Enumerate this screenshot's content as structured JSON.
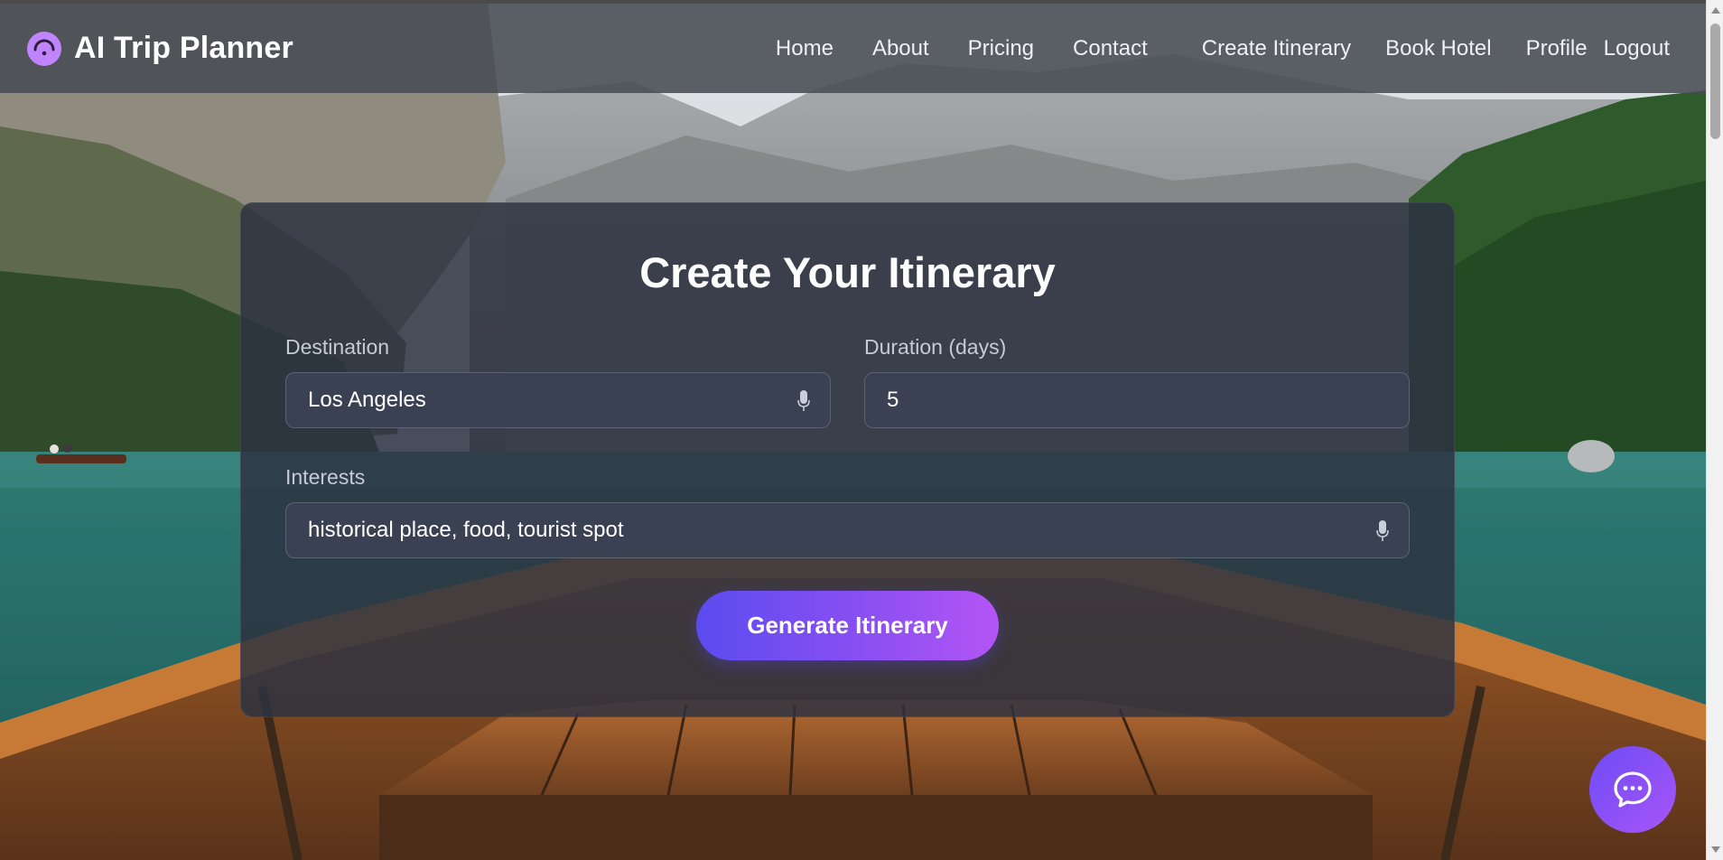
{
  "brand": {
    "title": "AI Trip Planner",
    "icon": "compass-icon"
  },
  "nav": {
    "home": "Home",
    "about": "About",
    "pricing": "Pricing",
    "contact": "Contact",
    "create_itinerary": "Create Itinerary",
    "book_hotel": "Book Hotel",
    "profile": "Profile",
    "logout": "Logout"
  },
  "form": {
    "title": "Create Your Itinerary",
    "destination": {
      "label": "Destination",
      "value": "Los Angeles",
      "icon": "microphone-icon"
    },
    "duration": {
      "label": "Duration (days)",
      "value": "5"
    },
    "interests": {
      "label": "Interests",
      "value": "historical place, food, tourist spot",
      "icon": "microphone-icon"
    },
    "submit_label": "Generate Itinerary"
  },
  "chat": {
    "icon": "chat-bubble-icon"
  },
  "colors": {
    "accent_start": "#5b4cf0",
    "accent_end": "#b455f5",
    "brand_icon": "#c084fc",
    "card_bg": "#2c3240"
  }
}
